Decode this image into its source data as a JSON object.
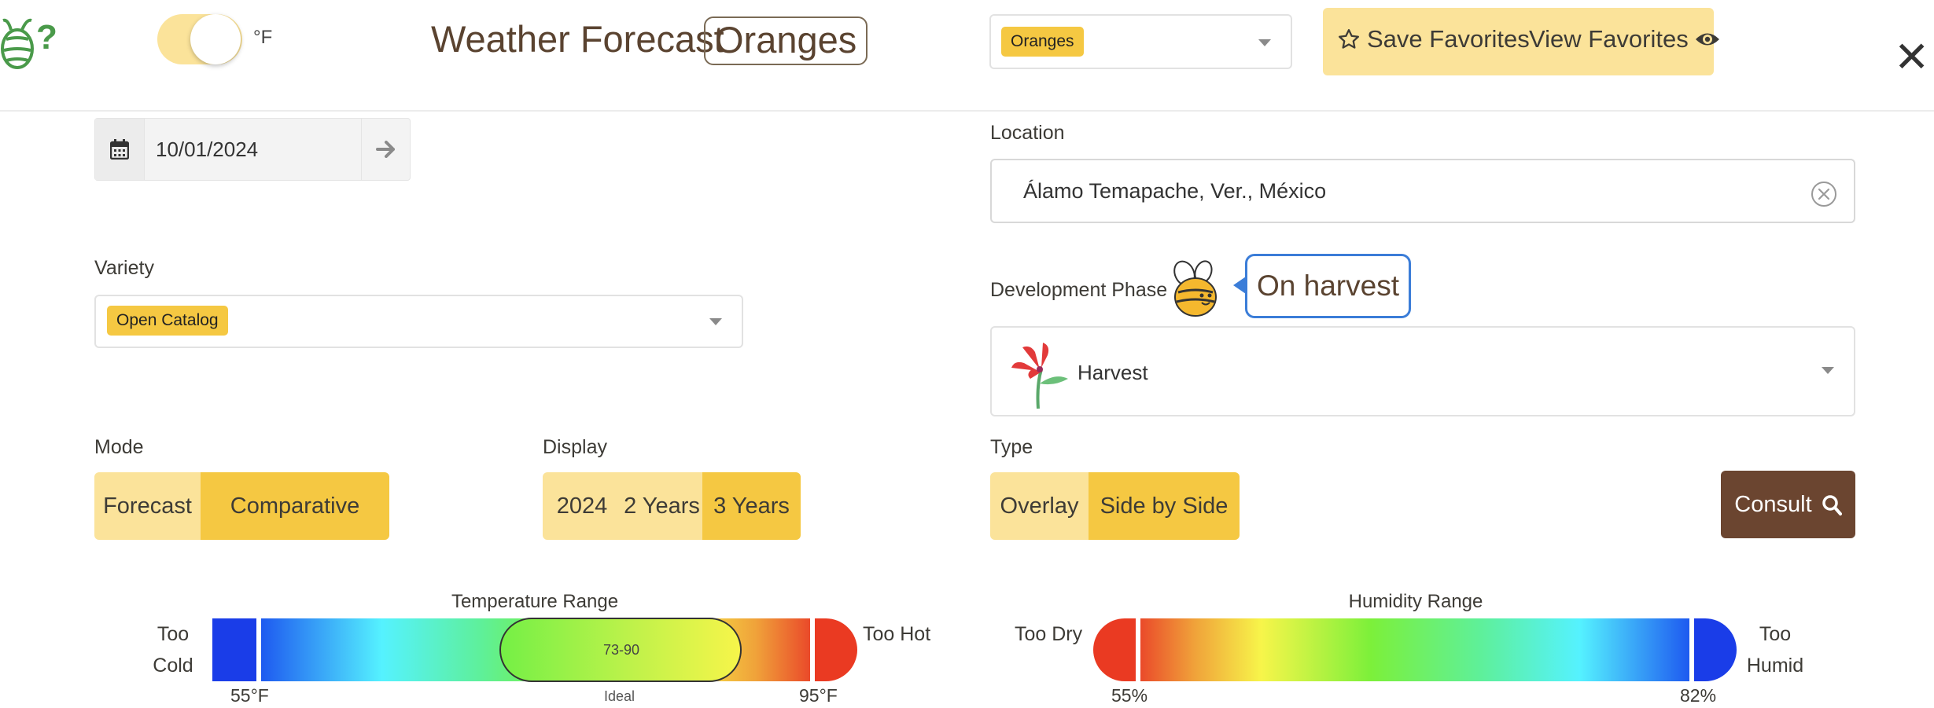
{
  "header": {
    "unit_label": "°F",
    "title": "Weather Forecast",
    "crop_badge": "Oranges",
    "crop_select_value": "Oranges",
    "save_favorites": "Save Favorites",
    "view_favorites": "View Favorites",
    "close_symbol": "✕",
    "toggle_on": true
  },
  "date": {
    "value": "10/01/2024"
  },
  "location": {
    "label": "Location",
    "value": "Álamo Temapache, Ver., México"
  },
  "variety": {
    "label": "Variety",
    "value": "Open Catalog"
  },
  "phase": {
    "label": "Development Phase",
    "bubble": "On harvest",
    "value": "Harvest"
  },
  "mode": {
    "label": "Mode",
    "options": [
      "Forecast",
      "Comparative"
    ],
    "selected": "Comparative"
  },
  "display": {
    "label": "Display",
    "options": [
      "2024",
      "2 Years",
      "3 Years"
    ],
    "selected": "3 Years"
  },
  "type": {
    "label": "Type",
    "options": [
      "Overlay",
      "Side by Side"
    ],
    "selected": "Side by Side"
  },
  "consult_button": "Consult",
  "temperature_gauge": {
    "title": "Temperature Range",
    "left_label_1": "Too",
    "left_label_2": "Cold",
    "right_label": "Too Hot",
    "min_tick": "55°F",
    "max_tick": "95°F",
    "ideal_range": "73-90",
    "ideal_label": "Ideal"
  },
  "humidity_gauge": {
    "title": "Humidity Range",
    "left_label": "Too Dry",
    "right_label_1": "Too",
    "right_label_2": "Humid",
    "min_tick": "55%",
    "max_tick": "82%"
  },
  "colors": {
    "accent_yellow": "#f5c842",
    "light_yellow": "#fbe39a",
    "brown": "#6b4530",
    "bubble_blue": "#3b7dd8"
  }
}
